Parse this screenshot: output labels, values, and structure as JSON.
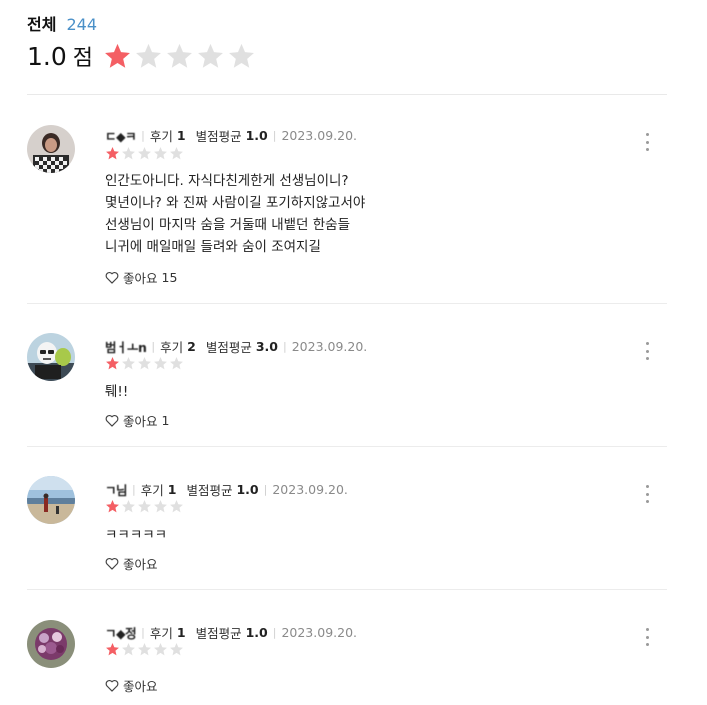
{
  "summary": {
    "label": "전체",
    "count": "244",
    "rating": "1.0",
    "unit": "점",
    "stars_filled": 1,
    "stars_total": 5
  },
  "colors": {
    "star_on": "#f45f64",
    "star_off": "#e0e0e0",
    "count_link": "#4a90c8"
  },
  "reviews": [
    {
      "nickname": "ㄷ◆ㅋ",
      "reviews_label": "후기",
      "reviews_count": "1",
      "avg_label": "별점평균",
      "avg_value": "1.0",
      "date": "2023.09.20.",
      "stars_filled": 1,
      "text_lines": [
        "인간도아니다.  자식다친게한게 선생님이니?",
        "몇년이나? 와 진짜 사람이길 포기하지않고서야",
        "선생님이 마지막 숨을 거둘때 내뱉던 한숨들",
        "니귀에 매일매일 들려와 숨이 조여지길"
      ],
      "like_label": "좋아요",
      "like_count": "15",
      "avatar_icon": "user-photo-checkered-shirt"
    },
    {
      "nickname": "범ㅓㅗn",
      "reviews_label": "후기",
      "reviews_count": "2",
      "avg_label": "별점평균",
      "avg_value": "3.0",
      "date": "2023.09.20.",
      "stars_filled": 1,
      "text_lines": [
        "퉤!!"
      ],
      "like_label": "좋아요",
      "like_count": "1",
      "avatar_icon": "user-photo-stormtrooper"
    },
    {
      "nickname": "ㄱ님",
      "reviews_label": "후기",
      "reviews_count": "1",
      "avg_label": "별점평균",
      "avg_value": "1.0",
      "date": "2023.09.20.",
      "stars_filled": 1,
      "text_lines": [
        "ㅋㅋㅋㅋㅋ"
      ],
      "like_label": "좋아요",
      "like_count": "",
      "avatar_icon": "user-photo-beach"
    },
    {
      "nickname": "ㄱ◆정",
      "reviews_label": "후기",
      "reviews_count": "1",
      "avg_label": "별점평균",
      "avg_value": "1.0",
      "date": "2023.09.20.",
      "stars_filled": 1,
      "text_lines": [],
      "like_label": "좋아요",
      "like_count": "",
      "avatar_icon": "user-photo-flowers"
    }
  ]
}
